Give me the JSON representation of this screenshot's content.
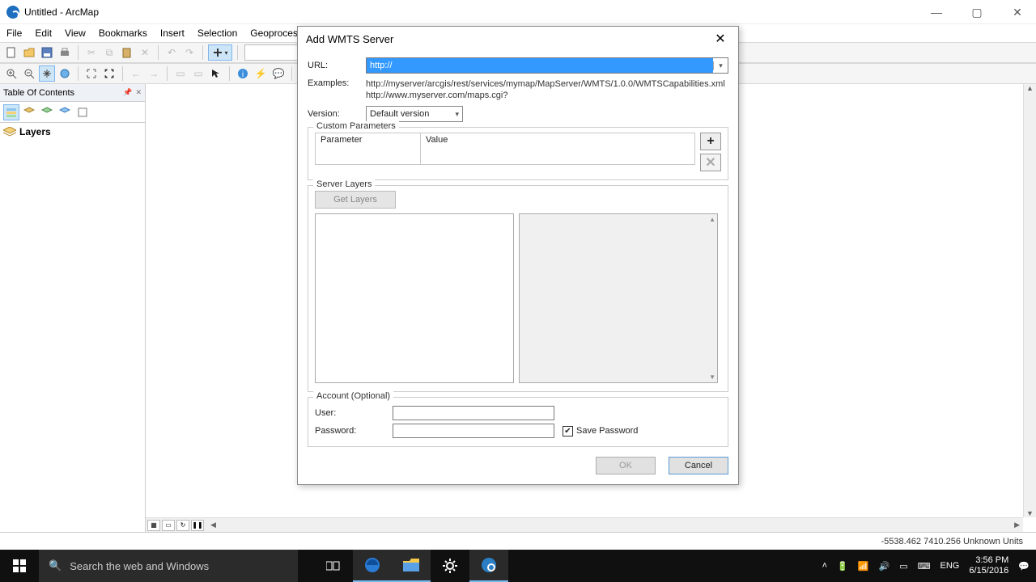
{
  "window": {
    "title": "Untitled - ArcMap"
  },
  "menu": [
    "File",
    "Edit",
    "View",
    "Bookmarks",
    "Insert",
    "Selection",
    "Geoprocessing"
  ],
  "toc": {
    "header": "Table Of Contents",
    "root": "Layers"
  },
  "status": {
    "coords": "-5538.462  7410.256 Unknown Units"
  },
  "dialog": {
    "title": "Add WMTS Server",
    "url_label": "URL:",
    "url_value": "http://",
    "examples_label": "Examples:",
    "example1": "http://myserver/arcgis/rest/services/mymap/MapServer/WMTS/1.0.0/WMTSCapabilities.xml",
    "example2": "http://www.myserver.com/maps.cgi?",
    "version_label": "Version:",
    "version_value": "Default version",
    "custom_params_label": "Custom Parameters",
    "param_header_param": "Parameter",
    "param_header_value": "Value",
    "server_layers_label": "Server Layers",
    "get_layers": "Get Layers",
    "account_label": "Account (Optional)",
    "user_label": "User:",
    "password_label": "Password:",
    "save_password_label": "Save Password",
    "ok": "OK",
    "cancel": "Cancel"
  },
  "taskbar": {
    "search_placeholder": "Search the web and Windows",
    "lang": "ENG",
    "time": "3:56 PM",
    "date": "6/15/2016"
  }
}
